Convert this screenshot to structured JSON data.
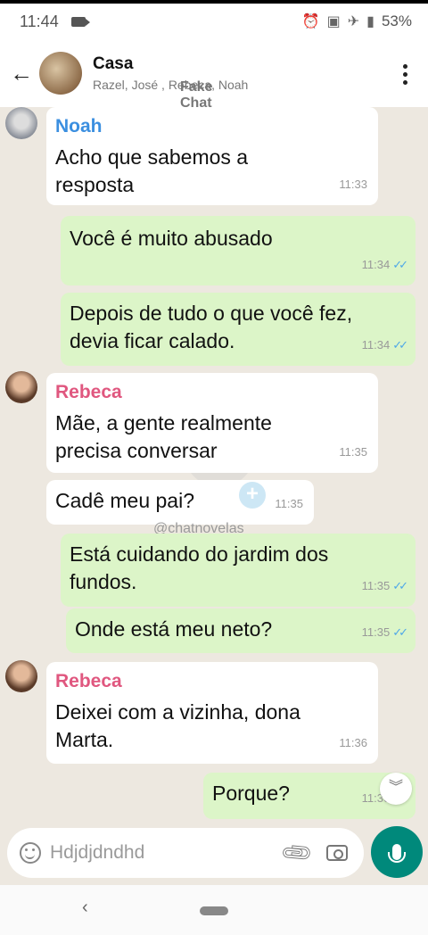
{
  "status_bar": {
    "time": "11:44",
    "battery": "53%"
  },
  "header": {
    "title": "Casa",
    "participants": "Razel, José , Rebeca, Noah",
    "overlay_watermark": "Fake Chat"
  },
  "watermark": "@chatnovelas",
  "messages": [
    {
      "dir": "in",
      "sender": "Noah",
      "text_lines": [
        "Acho que sabemos a",
        "resposta"
      ],
      "time": "11:33"
    },
    {
      "dir": "out",
      "text_lines": [
        "Você é muito abusado"
      ],
      "time": "11:34"
    },
    {
      "dir": "out",
      "text_lines": [
        "Depois de tudo o que você fez,",
        "devia ficar calado."
      ],
      "time": "11:34"
    },
    {
      "dir": "in",
      "sender": "Rebeca",
      "text_lines": [
        "Mãe, a gente realmente",
        "precisa conversar"
      ],
      "time": "11:35"
    },
    {
      "dir": "in",
      "text_lines": [
        "Cadê meu pai?"
      ],
      "time": "11:35"
    },
    {
      "dir": "out",
      "text_lines": [
        "Está cuidando do jardim dos",
        "fundos."
      ],
      "time": "11:35"
    },
    {
      "dir": "out",
      "text_lines": [
        "Onde está meu neto?"
      ],
      "time": "11:35"
    },
    {
      "dir": "in",
      "sender": "Rebeca",
      "text_lines": [
        "Deixei com a vizinha, dona",
        "Marta."
      ],
      "time": "11:36"
    },
    {
      "dir": "out",
      "text_lines": [
        "Porque?"
      ],
      "time": "11:36"
    }
  ],
  "composer": {
    "input_value": "Hdjdjdndhd"
  },
  "colors": {
    "noah_name": "#3b8fe0",
    "rebeca_name": "#e0577f",
    "outgoing_bubble": "#dcf5c8",
    "incoming_bubble": "#ffffff",
    "chat_background": "#ede8e0",
    "mic_button": "#00897b",
    "read_ticks": "#4fa8e8"
  },
  "icons": {
    "back": "arrow-left-icon",
    "more": "more-vertical-icon",
    "emoji": "emoji-icon",
    "attach": "paperclip-icon",
    "camera": "camera-icon",
    "mic": "microphone-icon",
    "scroll": "chevron-double-down-icon"
  }
}
